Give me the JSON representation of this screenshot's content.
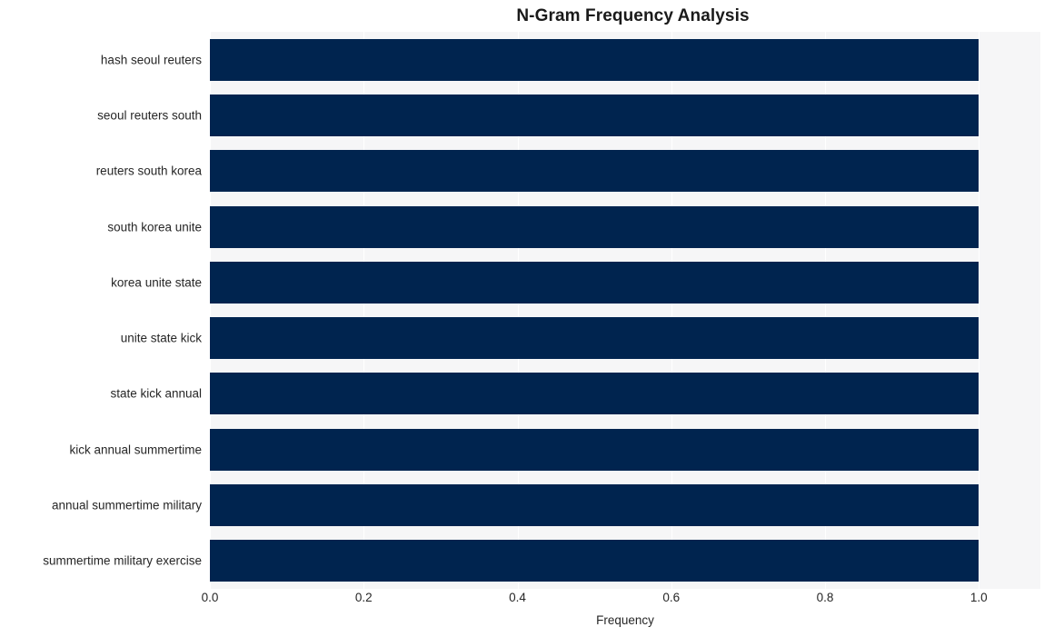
{
  "chart_data": {
    "type": "bar",
    "orientation": "horizontal",
    "title": "N-Gram Frequency Analysis",
    "xlabel": "Frequency",
    "ylabel": "",
    "categories": [
      "hash seoul reuters",
      "seoul reuters south",
      "reuters south korea",
      "south korea unite",
      "korea unite state",
      "unite state kick",
      "state kick annual",
      "kick annual summertime",
      "annual summertime military",
      "summertime military exercise"
    ],
    "values": [
      1.0,
      1.0,
      1.0,
      1.0,
      1.0,
      1.0,
      1.0,
      1.0,
      1.0,
      1.0
    ],
    "xlim": [
      0.0,
      1.08
    ],
    "xticks": [
      0.0,
      0.2,
      0.4,
      0.6,
      0.8,
      1.0
    ],
    "xtick_labels": [
      "0.0",
      "0.2",
      "0.4",
      "0.6",
      "0.8",
      "1.0"
    ],
    "grid": "vertical-white-on-gray",
    "legend": null,
    "bar_color": "#00244f",
    "plot_background": "#f6f6f7",
    "figure_background": "#ffffff",
    "text_color": "#262626"
  }
}
